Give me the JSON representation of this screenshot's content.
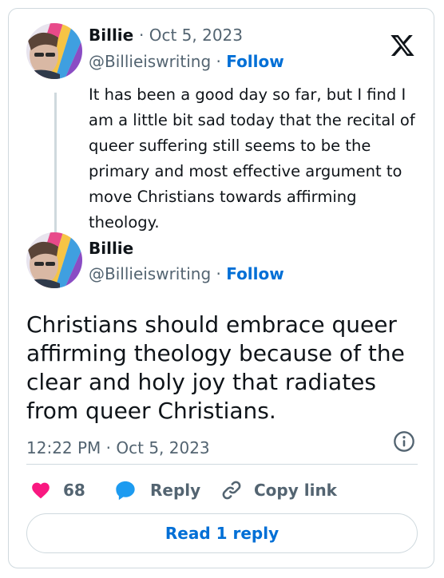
{
  "reply_tweet": {
    "author_name": "Billie",
    "separator": "·",
    "date": "Oct 5, 2023",
    "handle": "@Billieiswriting",
    "follow_label": "Follow",
    "text": "It has been a good day so far, but I find I am a little bit sad today that the recital of queer suffering still seems to be the primary and most effective argument to move Christians towards affirming theology."
  },
  "main_tweet": {
    "author_name": "Billie",
    "handle": "@Billieiswriting",
    "separator": "·",
    "follow_label": "Follow",
    "text": "Christians should embrace queer affirming theology because of the clear and holy joy that radiates from queer Christians.",
    "timestamp": "12:22 PM · Oct 5, 2023"
  },
  "actions": {
    "like_count": "68",
    "reply_label": "Reply",
    "copy_link_label": "Copy link"
  },
  "read_replies_label": "Read 1 reply",
  "icons": {
    "logo": "x-logo-icon",
    "like": "heart-icon",
    "reply": "speech-bubble-icon",
    "copy": "link-icon",
    "info": "info-icon"
  },
  "colors": {
    "link_blue": "#006fd6",
    "heart_pink": "#f91880",
    "reply_blue": "#1d9bf0",
    "muted_gray": "#536471",
    "border": "#cfd9de"
  }
}
